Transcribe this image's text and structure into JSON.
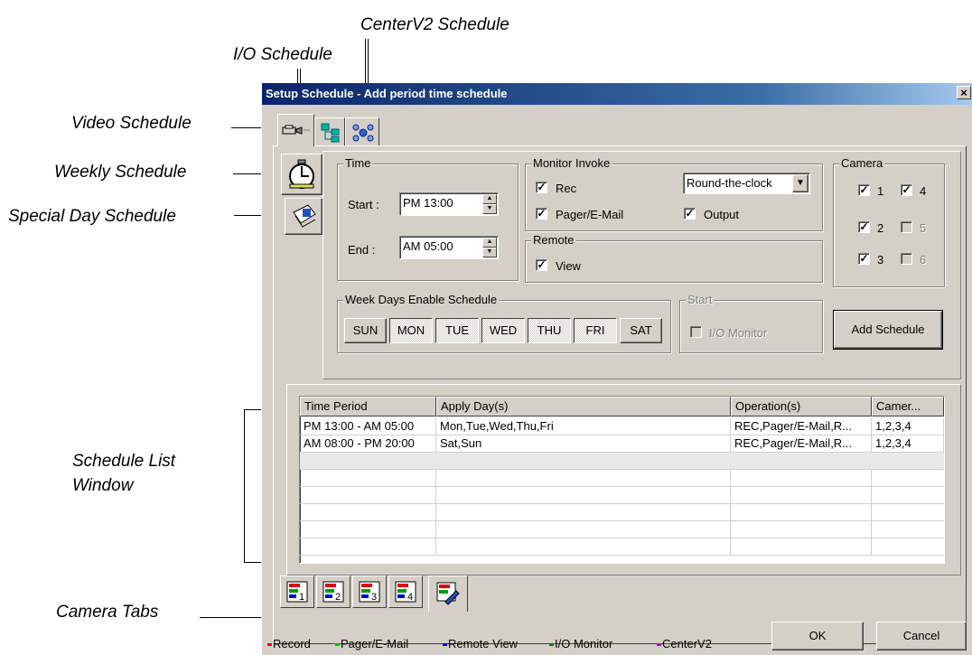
{
  "callouts": {
    "centerv2_schedule": "CenterV2 Schedule",
    "io_schedule": "I/O Schedule",
    "video_schedule": "Video Schedule",
    "weekly_schedule": "Weekly Schedule",
    "special_day_schedule": "Special Day Schedule",
    "schedule_list_window_1": "Schedule List",
    "schedule_list_window_2": "Window",
    "camera_tabs": "Camera Tabs"
  },
  "window": {
    "title": "Setup Schedule - Add period time schedule",
    "close": "×"
  },
  "time_group": {
    "legend": "Time",
    "start_label": "Start :",
    "start_value": "PM 13:00",
    "end_label": "End :",
    "end_value": "AM 05:00"
  },
  "monitor_invoke": {
    "legend": "Monitor Invoke",
    "rec": "Rec",
    "pager": "Pager/E-Mail",
    "output": "Output",
    "mode_value": "Round-the-clock"
  },
  "remote": {
    "legend": "Remote",
    "view": "View"
  },
  "camera_group": {
    "legend": "Camera",
    "cams": [
      {
        "label": "1",
        "checked": true,
        "enabled": true
      },
      {
        "label": "4",
        "checked": true,
        "enabled": true
      },
      {
        "label": "2",
        "checked": true,
        "enabled": true
      },
      {
        "label": "5",
        "checked": false,
        "enabled": false
      },
      {
        "label": "3",
        "checked": true,
        "enabled": true
      },
      {
        "label": "6",
        "checked": false,
        "enabled": false
      }
    ]
  },
  "weekdays": {
    "legend": "Week Days Enable Schedule",
    "days": [
      "SUN",
      "MON",
      "TUE",
      "WED",
      "THU",
      "FRI",
      "SAT"
    ]
  },
  "start_group": {
    "legend": "Start",
    "io_monitor": "I/O Monitor"
  },
  "add_schedule": "Add Schedule",
  "table": {
    "headers": [
      "Time Period",
      "Apply Day(s)",
      "Operation(s)",
      "Camer..."
    ],
    "rows": [
      [
        "PM 13:00 - AM 05:00",
        "Mon,Tue,Wed,Thu,Fri",
        "REC,Pager/E-Mail,R...",
        "1,2,3,4"
      ],
      [
        "AM 08:00 - PM 20:00",
        "Sat,Sun",
        "REC,Pager/E-Mail,R...",
        "1,2,3,4"
      ]
    ]
  },
  "camera_tabs": [
    "1",
    "2",
    "3",
    "4"
  ],
  "legend_keys": [
    {
      "label": "Record",
      "color": "#ff0000"
    },
    {
      "label": "Pager/E-Mail",
      "color": "#00c000"
    },
    {
      "label": "Remote View",
      "color": "#0000ff"
    },
    {
      "label": "I/O Monitor",
      "color": "#008000"
    },
    {
      "label": "CenterV2",
      "color": "#c000c0"
    }
  ],
  "buttons": {
    "ok": "OK",
    "cancel": "Cancel"
  },
  "check_mark": "✓"
}
